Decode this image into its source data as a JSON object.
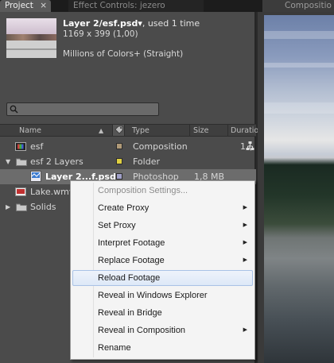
{
  "tabs": {
    "project": "Project",
    "project_close": "×",
    "effect_controls": "Effect Controls: jezero",
    "panel_menu": "▾≡",
    "composition": "Compositio"
  },
  "info": {
    "name": "Layer 2/esf.psd▾",
    "used": ", used 1 time",
    "dimensions": "1169 x 399 (1,00)",
    "colors": "Millions of Colors+ (Straight)"
  },
  "search": {
    "placeholder": ""
  },
  "columns": {
    "name": "Name",
    "type": "Type",
    "size": "Size",
    "duration": "Duratio"
  },
  "rows": [
    {
      "name": "esf",
      "label_color": "#b09a78",
      "type": "Composition",
      "size": "",
      "duration": "1 ("
    },
    {
      "name": "esf 2 Layers",
      "label_color": "#e0d040",
      "type": "Folder",
      "size": "",
      "duration": ""
    },
    {
      "name": "Layer 2...f.psd",
      "label_color": "#a0a0c8",
      "type": "Photoshop",
      "size": "1,8 MB",
      "duration": ""
    },
    {
      "name": "Lake.wmv",
      "label_color": "#a0a0c8",
      "type": "",
      "size": "",
      "duration": ""
    },
    {
      "name": "Solids",
      "label_color": "#e0d040",
      "type": "",
      "size": "",
      "duration": ""
    }
  ],
  "context_menu": {
    "items": [
      {
        "label": "Composition Settings...",
        "enabled": false,
        "submenu": false
      },
      {
        "label": "Create Proxy",
        "enabled": true,
        "submenu": true
      },
      {
        "label": "Set Proxy",
        "enabled": true,
        "submenu": true
      },
      {
        "label": "Interpret Footage",
        "enabled": true,
        "submenu": true
      },
      {
        "label": "Replace Footage",
        "enabled": true,
        "submenu": true
      },
      {
        "label": "Reload Footage",
        "enabled": true,
        "submenu": false,
        "highlighted": true
      },
      {
        "label": "Reveal in Windows Explorer",
        "enabled": true,
        "submenu": false
      },
      {
        "label": "Reveal in Bridge",
        "enabled": true,
        "submenu": false
      },
      {
        "label": "Reveal in Composition",
        "enabled": true,
        "submenu": true
      },
      {
        "label": "Rename",
        "enabled": true,
        "submenu": false
      }
    ],
    "submenu_arrow": "▶"
  }
}
